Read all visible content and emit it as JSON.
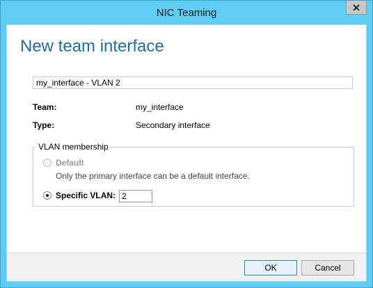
{
  "window": {
    "title": "NIC Teaming",
    "close_glyph": "✕"
  },
  "dialog": {
    "heading": "New team interface",
    "name_value": "my_interface - VLAN 2",
    "team_label": "Team:",
    "team_value": "my_interface",
    "type_label": "Type:",
    "type_value": "Secondary interface"
  },
  "vlan": {
    "group_label": "VLAN membership",
    "default_label": "Default",
    "default_hint": "Only the primary interface can be a default interface.",
    "default_selected": false,
    "default_enabled": false,
    "specific_label": "Specific VLAN:",
    "specific_selected": true,
    "specific_value": "2"
  },
  "buttons": {
    "ok_label": "OK",
    "cancel_label": "Cancel"
  },
  "colors": {
    "title_bar": "#5fcdf3",
    "heading": "#1f6aaa"
  }
}
